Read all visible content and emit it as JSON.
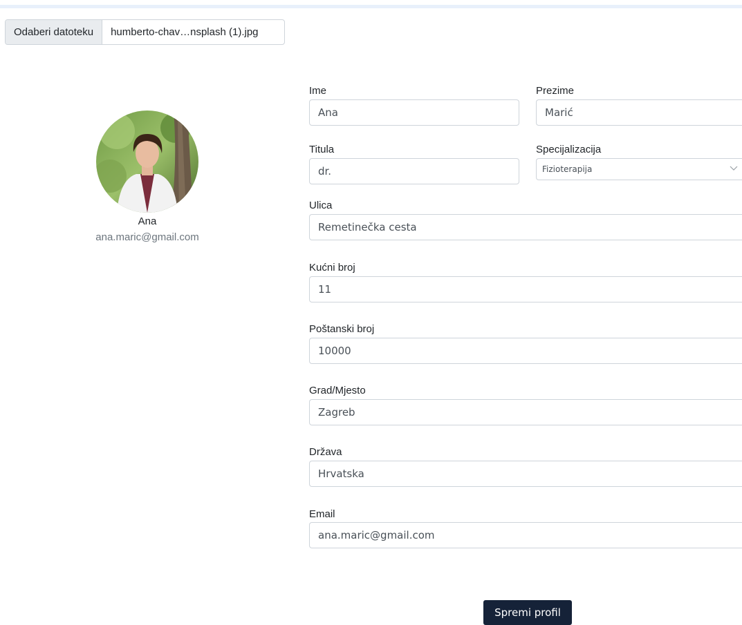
{
  "file_input": {
    "button_label": "Odaberi datoteku",
    "file_name": "humberto-chav…nsplash (1).jpg"
  },
  "profile": {
    "name": "Ana",
    "email": "ana.maric@gmail.com"
  },
  "form": {
    "ime": {
      "label": "Ime",
      "value": "Ana"
    },
    "prezime": {
      "label": "Prezime",
      "value": "Marić"
    },
    "titula": {
      "label": "Titula",
      "value": "dr."
    },
    "specijalizacija": {
      "label": "Specijalizacija",
      "selected": "Fizioterapija"
    },
    "ulica": {
      "label": "Ulica",
      "value": "Remetinečka cesta"
    },
    "kucni_broj": {
      "label": "Kućni broj",
      "value": "11"
    },
    "postanski_broj": {
      "label": "Poštanski broj",
      "value": "10000"
    },
    "grad": {
      "label": "Grad/Mjesto",
      "value": "Zagreb"
    },
    "drzava": {
      "label": "Država",
      "value": "Hrvatska"
    },
    "email": {
      "label": "Email",
      "value": "ana.maric@gmail.com"
    }
  },
  "actions": {
    "save_label": "Spremi profil"
  },
  "colors": {
    "save_button_bg": "#152238",
    "input_border": "#ced4da",
    "file_button_bg": "#e9ecef"
  },
  "icons": {
    "select_arrow": "chevron-down-icon"
  }
}
